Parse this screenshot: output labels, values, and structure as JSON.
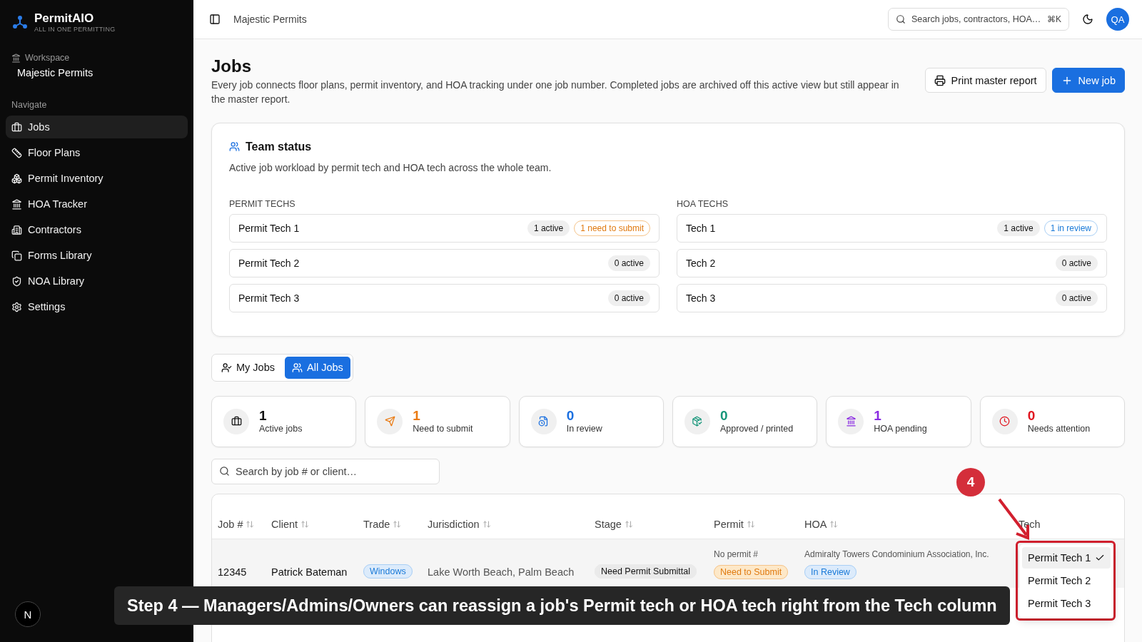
{
  "brand": {
    "name": "PermitAIO",
    "tagline": "ALL IN ONE PERMITTING"
  },
  "workspace": {
    "label": "Workspace",
    "name": "Majestic Permits"
  },
  "nav": {
    "heading": "Navigate",
    "items": [
      {
        "label": "Jobs",
        "kind": "briefcase",
        "selected": true
      },
      {
        "label": "Floor Plans",
        "kind": "ruler",
        "selected": false
      },
      {
        "label": "Permit Inventory",
        "kind": "boxes",
        "selected": false
      },
      {
        "label": "HOA Tracker",
        "kind": "bank",
        "selected": false
      },
      {
        "label": "Contractors",
        "kind": "building",
        "selected": false
      },
      {
        "label": "Forms Library",
        "kind": "copy",
        "selected": false
      },
      {
        "label": "NOA Library",
        "kind": "shield",
        "selected": false
      },
      {
        "label": "Settings",
        "kind": "gear",
        "selected": false
      }
    ]
  },
  "dev_badge": "N",
  "topbar": {
    "breadcrumb": "Majestic Permits",
    "search": {
      "placeholder": "Search jobs, contractors, HOA…",
      "shortcut": "⌘K"
    },
    "avatar": "QA"
  },
  "page": {
    "title": "Jobs",
    "description": "Every job connects floor plans, permit inventory, and HOA tracking under one job number. Completed jobs are archived off this active view but still appear in the master report.",
    "buttons": [
      {
        "label": "Print master report",
        "kind": "outline"
      },
      {
        "label": "New job",
        "kind": "primary"
      }
    ]
  },
  "team_status": {
    "title": "Team status",
    "subtitle": "Active job workload by permit tech and HOA tech across the whole team.",
    "groups": [
      {
        "heading": "PERMIT TECHS",
        "members": [
          {
            "name": "Permit Tech 1",
            "badges": [
              {
                "text": "1 active",
                "kind": "neutral"
              },
              {
                "text": "1 need to submit",
                "kind": "orange"
              }
            ]
          },
          {
            "name": "Permit Tech 2",
            "badges": [
              {
                "text": "0 active",
                "kind": "neutral"
              }
            ]
          },
          {
            "name": "Permit Tech 3",
            "badges": [
              {
                "text": "0 active",
                "kind": "neutral"
              }
            ]
          }
        ]
      },
      {
        "heading": "HOA TECHS",
        "members": [
          {
            "name": "Tech 1",
            "badges": [
              {
                "text": "1 active",
                "kind": "neutral"
              },
              {
                "text": "1 in review",
                "kind": "blue"
              }
            ]
          },
          {
            "name": "Tech 2",
            "badges": [
              {
                "text": "0 active",
                "kind": "neutral"
              }
            ]
          },
          {
            "name": "Tech 3",
            "badges": [
              {
                "text": "0 active",
                "kind": "neutral"
              }
            ]
          }
        ]
      }
    ]
  },
  "view_tabs": [
    {
      "label": "My Jobs",
      "selected": false
    },
    {
      "label": "All Jobs",
      "selected": true
    }
  ],
  "stats": [
    {
      "value": "1",
      "label": "Active jobs",
      "kind": "briefcase",
      "color": "#111111"
    },
    {
      "value": "1",
      "label": "Need to submit",
      "kind": "send",
      "color": "#ea7a12"
    },
    {
      "value": "0",
      "label": "In review",
      "kind": "file",
      "color": "#1a6fe0"
    },
    {
      "value": "0",
      "label": "Approved / printed",
      "kind": "package",
      "color": "#16967a"
    },
    {
      "value": "1",
      "label": "HOA pending",
      "kind": "bank",
      "color": "#8a2be2"
    },
    {
      "value": "0",
      "label": "Needs attention",
      "kind": "clock",
      "color": "#e0141e"
    }
  ],
  "table_search": {
    "placeholder": "Search by job # or client…"
  },
  "table": {
    "columns": [
      "Job #",
      "Client",
      "Trade",
      "Jurisdiction",
      "Stage",
      "Permit",
      "HOA",
      "Tech"
    ],
    "rows": [
      {
        "job": "12345",
        "client": "Patrick Bateman",
        "trade": "Windows",
        "jurisdiction": "Lake Worth Beach, Palm Beach",
        "stage": "Need Permit Submittal",
        "permit_number": "No permit #",
        "permit_status": "Need to Submit",
        "hoa_name": "Admiralty Towers Condominium Association, Inc.",
        "hoa_status": "In Review"
      }
    ]
  },
  "tech_menu": [
    {
      "label": "Permit Tech 1",
      "selected": true
    },
    {
      "label": "Permit Tech 2",
      "selected": false
    },
    {
      "label": "Permit Tech 3",
      "selected": false
    }
  ],
  "annotation": {
    "step": "4",
    "caption": "Step 4 — Managers/Admins/Owners can reassign a job's Permit tech or HOA tech right from the Tech column"
  }
}
